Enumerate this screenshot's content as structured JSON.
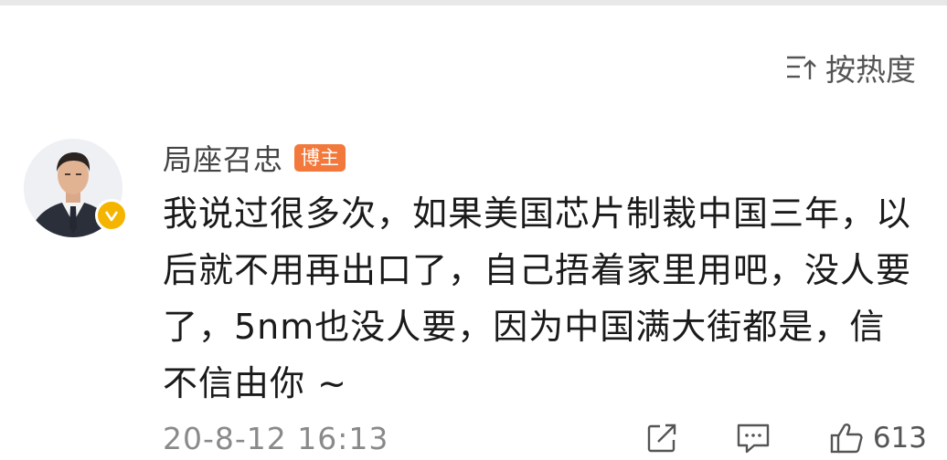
{
  "sort": {
    "label": "按热度",
    "icon": "sort-icon"
  },
  "comment": {
    "author": {
      "name": "局座召忠",
      "badge": "博主",
      "verified_icon": "verified-v-icon",
      "badge_color": "#f2793b",
      "verified_color": "#f5b400"
    },
    "text": "我说过很多次，如果美国芯片制裁中国三年，以后就不用再出口了，自己捂着家里用吧，没人要了，5nm也没人要，因为中国满大街都是，信不信由你 ~",
    "timestamp": "20-8-12 16:13",
    "actions": {
      "repost_icon": "repost-icon",
      "reply_icon": "comment-icon",
      "like_icon": "thumbs-up-icon",
      "like_count": "613"
    }
  }
}
